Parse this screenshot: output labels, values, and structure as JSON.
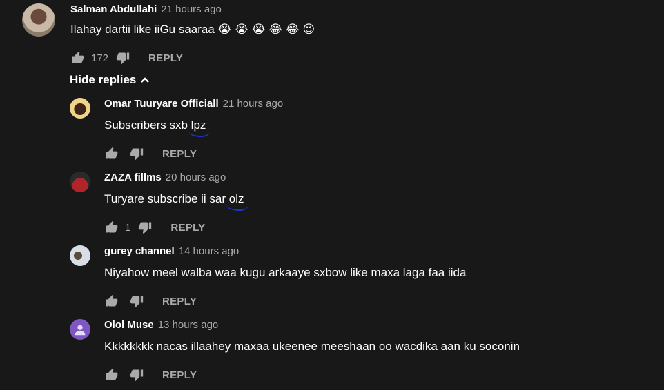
{
  "comment": {
    "author": "Salman Abdullahi",
    "time": "21 hours ago",
    "text": "Ilahay dartii like iiGu saaraa 😭 😭 😭 😂 😂 😉",
    "likes": "172",
    "reply_label": "REPLY"
  },
  "hide_replies_label": "Hide replies",
  "replies": [
    {
      "author": "Omar Tuuryare Officiall",
      "time": "21 hours ago",
      "text_prefix": "Subscribers sxb ",
      "text_underlined": "lpz",
      "text": "",
      "likes": "",
      "reply_label": "REPLY",
      "avatar_color": "#e8c88a"
    },
    {
      "author": "ZAZA fillms",
      "time": "20 hours ago",
      "text_prefix": "Turyare subscribe ii sar ",
      "text_underlined": "olz",
      "text": "",
      "likes": "1",
      "reply_label": "REPLY",
      "avatar_color": "#b0242a"
    },
    {
      "author": "gurey channel",
      "time": "14 hours ago",
      "text_prefix": "",
      "text_underlined": "",
      "text": "Niyahow meel walba waa kugu arkaaye sxbow like maxa laga faa iida",
      "likes": "",
      "reply_label": "REPLY",
      "avatar_color": "#d9dde6"
    },
    {
      "author": "Olol Muse",
      "time": "13 hours ago",
      "text_prefix": "",
      "text_underlined": "",
      "text": "Kkkkkkkk nacas illaahey maxaa ukeenee meeshaan oo wacdika aan ku soconin",
      "likes": "",
      "reply_label": "REPLY",
      "avatar_color": "#7e57c2"
    }
  ]
}
